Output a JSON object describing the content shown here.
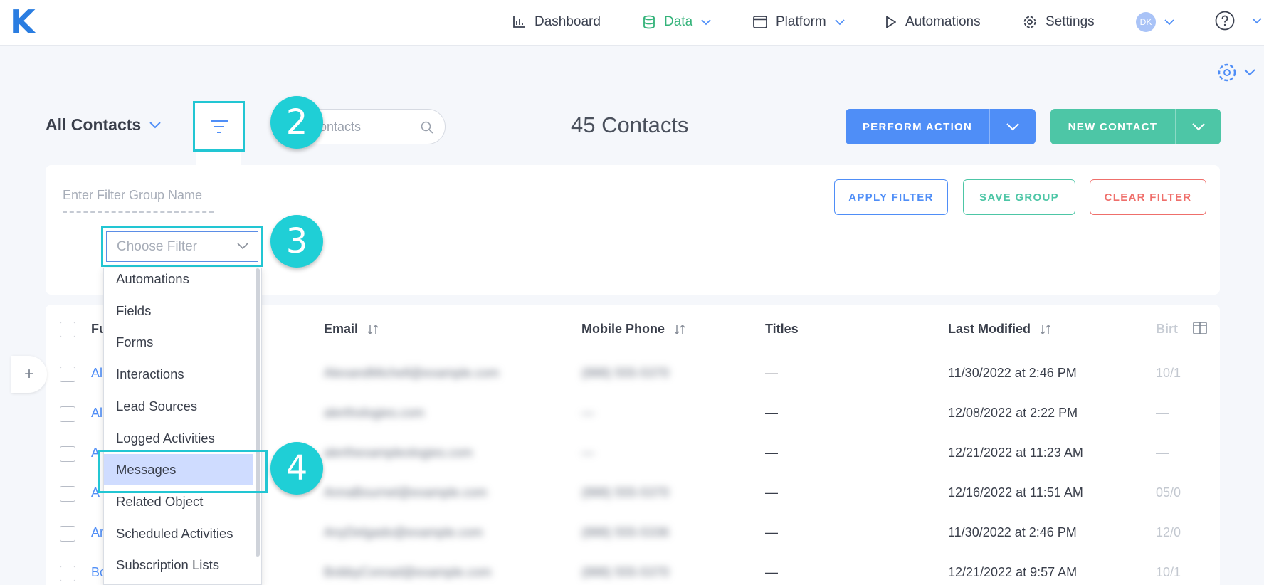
{
  "app": {
    "logo": "K"
  },
  "nav": {
    "dashboard": "Dashboard",
    "data": "Data",
    "platform": "Platform",
    "automations": "Automations",
    "settings": "Settings",
    "avatar_initials": "DK"
  },
  "colors": {
    "brand": "#2a7de1",
    "active": "#34b37a",
    "primary": "#4f8ef7",
    "success": "#4dc6a6",
    "danger": "#ef6f6b",
    "highlight": "#22c6d3"
  },
  "toolbar": {
    "view_label": "All Contacts",
    "search_placeholder": "ontacts",
    "count_label": "45 Contacts",
    "perform_action": "PERFORM ACTION",
    "new_contact": "NEW CONTACT"
  },
  "filter": {
    "group_name_placeholder": "Enter Filter Group Name",
    "apply": "APPLY FILTER",
    "save": "SAVE GROUP",
    "clear": "CLEAR FILTER",
    "choose_placeholder": "Choose Filter",
    "options": [
      "Automations",
      "Fields",
      "Forms",
      "Interactions",
      "Lead Sources",
      "Logged Activities",
      "Messages",
      "Related Object",
      "Scheduled Activities",
      "Subscription Lists"
    ],
    "selected": "Messages"
  },
  "table": {
    "headers": {
      "name": "Fu",
      "email": "Email",
      "mobile": "Mobile Phone",
      "titles": "Titles",
      "modified": "Last Modified",
      "birthday": "Birt"
    },
    "rows": [
      {
        "name": "Al",
        "email": "AlexandMichell@example.com",
        "phone": "(888) 555-5370",
        "titles": "—",
        "modified": "11/30/2022 at 2:46 PM",
        "birthday": "10/1"
      },
      {
        "name": "Al",
        "email": "alerthologies.com",
        "phone": "—",
        "titles": "—",
        "modified": "12/08/2022 at 2:22 PM",
        "birthday": "—"
      },
      {
        "name": "A",
        "email": "alerthexampleologies.com",
        "phone": "—",
        "titles": "—",
        "modified": "12/21/2022 at 11:23 AM",
        "birthday": "—"
      },
      {
        "name": "A",
        "email": "AnnaBournel@example.com",
        "phone": "(888) 555-5370",
        "titles": "—",
        "modified": "12/16/2022 at 11:51 AM",
        "birthday": "05/0"
      },
      {
        "name": "An",
        "email": "AnyDelgado@example.com",
        "phone": "(888) 555-5336",
        "titles": "—",
        "modified": "11/30/2022 at 2:46 PM",
        "birthday": "12/0"
      },
      {
        "name": "Bo",
        "email": "BobbyConrad@example.com",
        "phone": "(888) 555-5370",
        "titles": "—",
        "modified": "12/21/2022 at 9:57 AM",
        "birthday": "10/1"
      }
    ]
  },
  "steps": {
    "s2": "2",
    "s3": "3",
    "s4": "4"
  }
}
